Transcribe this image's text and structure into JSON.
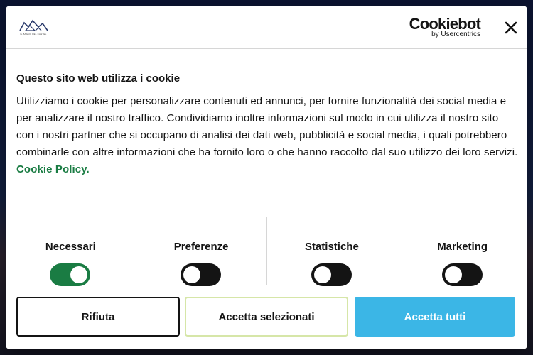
{
  "header": {
    "site_logo_text": "IL BAGNO DEL CASTEL",
    "cookiebot_name": "Cookiebot",
    "cookiebot_by": "by Usercentrics"
  },
  "content": {
    "title": "Questo sito web utilizza i cookie",
    "body": "Utilizziamo i cookie per personalizzare contenuti ed annunci, per fornire funzionalità dei social media e per analizzare il nostro traffico. Condividiamo inoltre informazioni sul modo in cui utilizza il nostro sito con i nostri partner che si occupano di analisi dei dati web, pubblicità e social media, i quali potrebbero combinarle con altre informazioni che ha fornito loro o che hanno raccolto dal suo utilizzo dei loro servizi.",
    "policy_link": "Cookie Policy."
  },
  "categories": [
    {
      "label": "Necessari",
      "enabled": true
    },
    {
      "label": "Preferenze",
      "enabled": false
    },
    {
      "label": "Statistiche",
      "enabled": false
    },
    {
      "label": "Marketing",
      "enabled": false
    }
  ],
  "buttons": {
    "reject": "Rifiuta",
    "accept_selected": "Accetta selezionati",
    "accept_all": "Accetta tutti"
  },
  "colors": {
    "accent_green": "#1a7c43",
    "accept_all_blue": "#3bb6e6",
    "toggle_off": "#141414"
  }
}
